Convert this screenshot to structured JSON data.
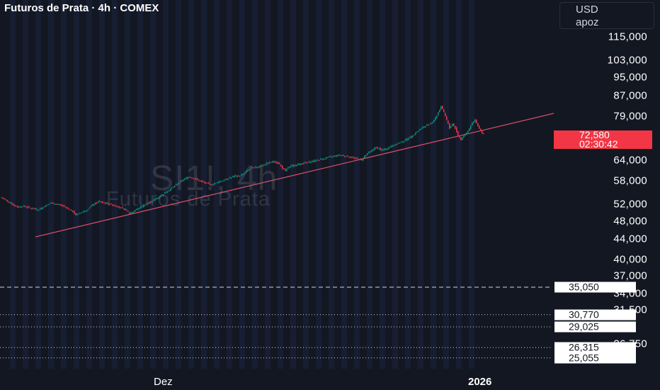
{
  "header": {
    "title": "Futuros de Prata · 4h · COMEX",
    "currency": "USD",
    "scale_mode": "apoz"
  },
  "watermark": {
    "symbol": "SI1!, 4h",
    "name": "Futuros de Prata"
  },
  "price_tag": {
    "price": "72,580",
    "countdown": "02:30:42",
    "color": "#f23645"
  },
  "level_tags": [
    "35,050",
    "30,770",
    "29,025",
    "26,315",
    "25,055"
  ],
  "y_axis_labels": [
    "115,000",
    "103,000",
    "95,000",
    "87,000",
    "79,000",
    "64,000",
    "58,000",
    "52,000",
    "48,000",
    "44,000",
    "40,000",
    "37,000",
    "34,000",
    "31,500",
    "26,750"
  ],
  "x_axis_labels": [
    "Dez",
    "2026"
  ],
  "colors": {
    "background": "#131722",
    "bar_stripe": "#1c2440",
    "up": "#089981",
    "down": "#f23645",
    "trendline": "#e0506a"
  },
  "chart_data": {
    "type": "candlestick",
    "title": "Futuros de Prata · 4h · COMEX",
    "symbol": "SI1!",
    "timeframe": "4h",
    "exchange": "COMEX",
    "currency": "USD",
    "y_scale": "log",
    "ylim": [
      23800,
      137000
    ],
    "x_ticks": [
      "Dez",
      "2026"
    ],
    "last_price": 72580,
    "close_path": [
      [
        0,
        53500
      ],
      [
        6,
        52300
      ],
      [
        10,
        51300
      ],
      [
        16,
        51500
      ],
      [
        20,
        51000
      ],
      [
        26,
        50600
      ],
      [
        30,
        51500
      ],
      [
        34,
        52300
      ],
      [
        38,
        52000
      ],
      [
        42,
        51700
      ],
      [
        46,
        51000
      ],
      [
        50,
        50200
      ],
      [
        52,
        49400
      ],
      [
        56,
        50000
      ],
      [
        60,
        50600
      ],
      [
        64,
        51800
      ],
      [
        68,
        52600
      ],
      [
        72,
        52300
      ],
      [
        76,
        52000
      ],
      [
        80,
        51600
      ],
      [
        84,
        51100
      ],
      [
        88,
        50500
      ],
      [
        90,
        49700
      ],
      [
        94,
        50500
      ],
      [
        98,
        51300
      ],
      [
        102,
        52000
      ],
      [
        106,
        52800
      ],
      [
        110,
        53600
      ],
      [
        114,
        54600
      ],
      [
        118,
        55600
      ],
      [
        122,
        56700
      ],
      [
        124,
        57300
      ],
      [
        128,
        58400
      ],
      [
        132,
        59200
      ],
      [
        136,
        58700
      ],
      [
        140,
        58000
      ],
      [
        144,
        57400
      ],
      [
        148,
        57000
      ],
      [
        152,
        57600
      ],
      [
        156,
        58200
      ],
      [
        160,
        58800
      ],
      [
        164,
        59300
      ],
      [
        168,
        59500
      ],
      [
        172,
        60600
      ],
      [
        176,
        61700
      ],
      [
        180,
        62000
      ],
      [
        184,
        62500
      ],
      [
        188,
        63200
      ],
      [
        192,
        63700
      ],
      [
        196,
        62800
      ],
      [
        198,
        61700
      ],
      [
        200,
        60800
      ],
      [
        202,
        61900
      ],
      [
        206,
        62500
      ],
      [
        210,
        62900
      ],
      [
        214,
        63200
      ],
      [
        218,
        63600
      ],
      [
        222,
        64000
      ],
      [
        226,
        64400
      ],
      [
        230,
        64900
      ],
      [
        234,
        65300
      ],
      [
        238,
        65600
      ],
      [
        242,
        65400
      ],
      [
        246,
        65000
      ],
      [
        250,
        64600
      ],
      [
        254,
        64200
      ],
      [
        256,
        65300
      ],
      [
        260,
        66800
      ],
      [
        264,
        68000
      ],
      [
        266,
        67700
      ],
      [
        268,
        67100
      ],
      [
        272,
        67700
      ],
      [
        276,
        68700
      ],
      [
        280,
        69400
      ],
      [
        284,
        70300
      ],
      [
        288,
        71400
      ],
      [
        292,
        72900
      ],
      [
        296,
        74500
      ],
      [
        300,
        75600
      ],
      [
        304,
        76800
      ],
      [
        306,
        78200
      ],
      [
        308,
        80300
      ],
      [
        310,
        82700
      ],
      [
        312,
        80300
      ],
      [
        314,
        77500
      ],
      [
        316,
        74500
      ],
      [
        318,
        76200
      ],
      [
        320,
        74500
      ],
      [
        322,
        72100
      ],
      [
        324,
        70600
      ],
      [
        326,
        71900
      ],
      [
        328,
        73000
      ],
      [
        330,
        74500
      ],
      [
        332,
        76400
      ],
      [
        334,
        77400
      ],
      [
        336,
        75200
      ],
      [
        338,
        73500
      ],
      [
        340,
        72580
      ]
    ],
    "trendline": {
      "label": "",
      "points": [
        [
          24,
          44500
        ],
        [
          390,
          80000
        ]
      ]
    },
    "horizontal_levels": [
      {
        "value": 35050,
        "style": "dashed"
      },
      {
        "value": 30770,
        "style": "dotted"
      },
      {
        "value": 29025,
        "style": "dotted"
      },
      {
        "value": 26315,
        "style": "dotted"
      },
      {
        "value": 25055,
        "style": "dotted"
      }
    ]
  }
}
